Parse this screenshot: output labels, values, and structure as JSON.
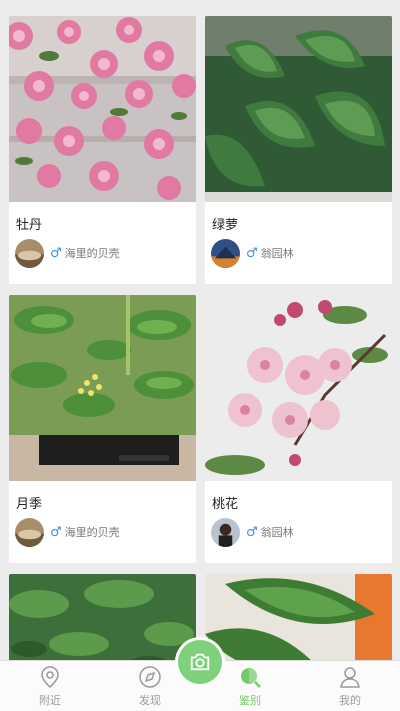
{
  "cards": [
    {
      "title": "牡丹",
      "gender_icon": "male-icon",
      "user": "海里的贝壳"
    },
    {
      "title": "绿萝",
      "gender_icon": "male-icon",
      "user": "翁园林"
    },
    {
      "title": "月季",
      "gender_icon": "male-icon",
      "user": "海里的贝壳"
    },
    {
      "title": "桃花",
      "gender_icon": "male-icon",
      "user": "翁园林"
    }
  ],
  "gender_symbol": "♂",
  "tabbar": {
    "items": [
      {
        "label": "附近",
        "icon": "location-icon"
      },
      {
        "label": "发现",
        "icon": "compass-icon"
      },
      {
        "label": "鉴别",
        "icon": "identify-icon"
      },
      {
        "label": "我的",
        "icon": "person-icon"
      }
    ],
    "active": "鉴别",
    "center_icon": "camera-icon"
  },
  "colors": {
    "accent": "#77c86d",
    "gender": "#3d8fd8",
    "background": "#ececec"
  }
}
